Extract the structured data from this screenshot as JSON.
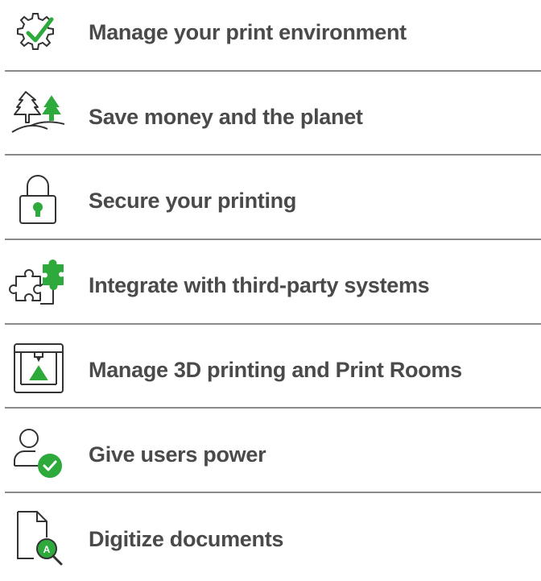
{
  "colors": {
    "accent": "#2eaa3c",
    "text": "#4a4a4a",
    "stroke": "#333333",
    "divider": "#8a8a8a"
  },
  "items": [
    {
      "label": "Manage your print environment",
      "icon": "gear-check-icon"
    },
    {
      "label": "Save money and the planet",
      "icon": "trees-icon"
    },
    {
      "label": "Secure your printing",
      "icon": "padlock-icon"
    },
    {
      "label": "Integrate with third-party systems",
      "icon": "puzzle-pieces-icon"
    },
    {
      "label": "Manage 3D printing and Print Rooms",
      "icon": "3d-printer-icon"
    },
    {
      "label": "Give users power",
      "icon": "user-check-icon"
    },
    {
      "label": "Digitize documents",
      "icon": "document-search-icon"
    }
  ]
}
